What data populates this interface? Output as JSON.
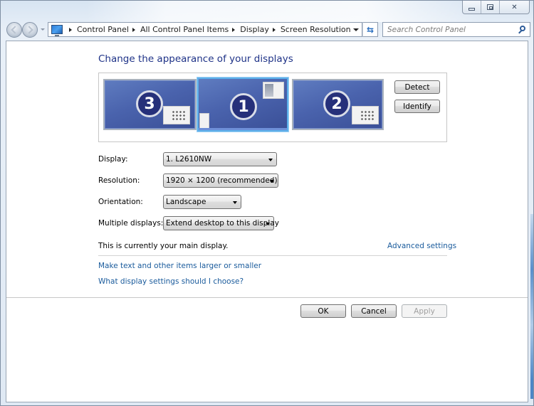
{
  "window": {
    "caption_buttons": [
      "minimize",
      "maximize",
      "close"
    ]
  },
  "address_bar": {
    "location_icon": "display-control-panel-icon",
    "breadcrumbs": [
      "Control Panel",
      "All Control Panel Items",
      "Display",
      "Screen Resolution"
    ],
    "refresh_icon": "refresh-icon"
  },
  "search": {
    "placeholder": "Search Control Panel",
    "value": ""
  },
  "page": {
    "title": "Change the appearance of your displays"
  },
  "monitors": [
    {
      "number": "3",
      "selected": false
    },
    {
      "number": "1",
      "selected": true
    },
    {
      "number": "2",
      "selected": false
    }
  ],
  "monitor_buttons": {
    "detect": "Detect",
    "identify": "Identify"
  },
  "form": {
    "display": {
      "label": "Display:",
      "value": "1. L2610NW"
    },
    "resolution": {
      "label": "Resolution:",
      "value": "1920 × 1200 (recommended)"
    },
    "orientation": {
      "label": "Orientation:",
      "value": "Landscape"
    },
    "multiple_displays": {
      "label": "Multiple displays:",
      "value": "Extend desktop to this display"
    }
  },
  "status": {
    "main_display": "This is currently your main display."
  },
  "links": {
    "advanced": "Advanced settings",
    "text_size": "Make text and other items larger or smaller",
    "which_settings": "What display settings should I choose?"
  },
  "dialog_buttons": {
    "ok": "OK",
    "cancel": "Cancel",
    "apply": "Apply",
    "apply_enabled": false
  }
}
